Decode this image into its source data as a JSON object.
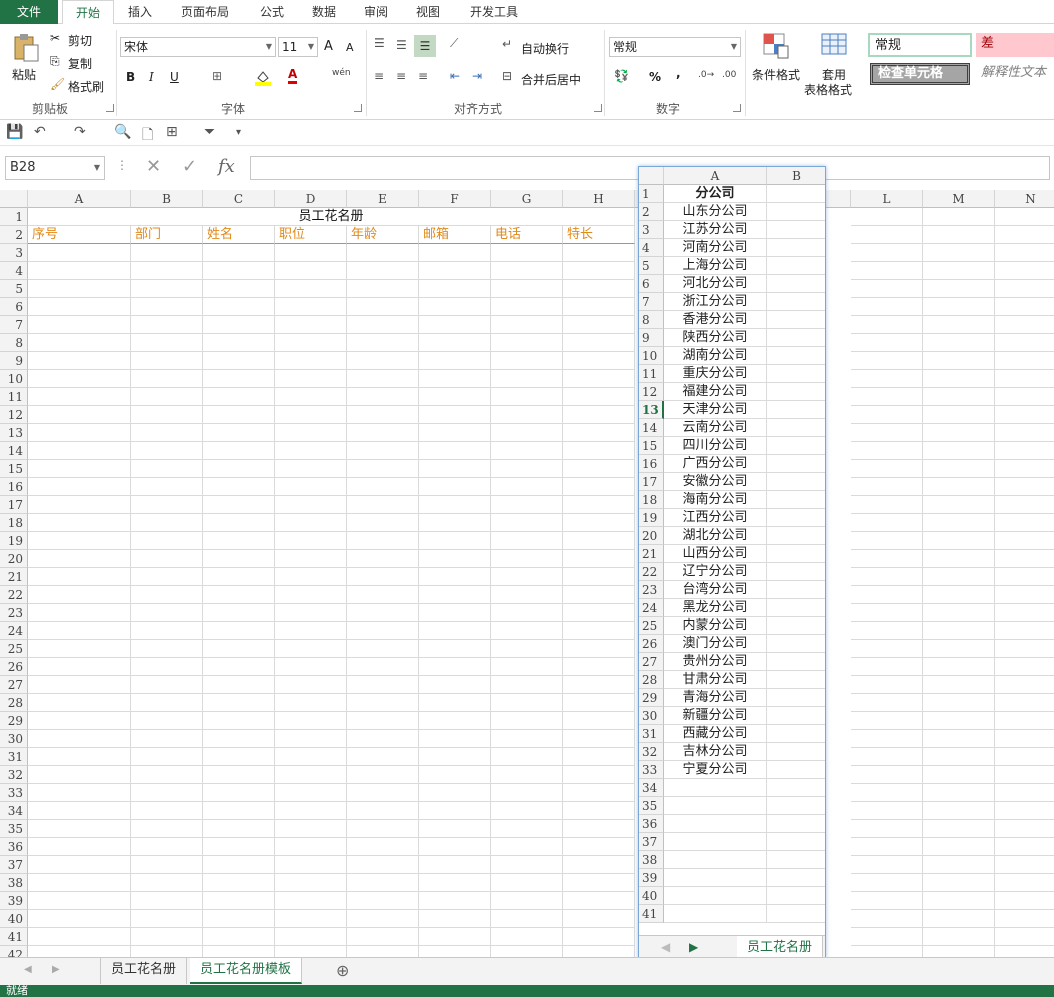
{
  "ribbon": {
    "tabs": [
      "文件",
      "开始",
      "插入",
      "页面布局",
      "公式",
      "数据",
      "审阅",
      "视图",
      "开发工具"
    ],
    "active_tab": "开始",
    "clipboard": {
      "paste": "粘贴",
      "cut": "剪切",
      "copy": "复制",
      "format_painter": "格式刷",
      "label": "剪贴板"
    },
    "font": {
      "name": "宋体",
      "size": "11",
      "bold": "B",
      "italic": "I",
      "underline": "U",
      "label": "字体",
      "grow": "A",
      "shrink": "A",
      "font_color_letter": "A",
      "phonetic": "wén"
    },
    "alignment": {
      "wrap": "自动换行",
      "merge": "合并后居中",
      "label": "对齐方式"
    },
    "number": {
      "format": "常规",
      "percent": "%",
      "comma": ",",
      "label": "数字"
    },
    "styles": {
      "conditional": "条件格式",
      "table_format_line1": "套用",
      "table_format_line2": "表格格式",
      "normal": "常规",
      "bad": "差",
      "check_cell": "检查单元格",
      "explanatory": "解释性文本"
    }
  },
  "formula_bar": {
    "name_box": "B28",
    "fx": "fx",
    "value": ""
  },
  "colors": {
    "accent": "#217346",
    "header_orange": "#e08a1a",
    "bad_bg": "#ffc7ce"
  },
  "main_sheet": {
    "columns": [
      "A",
      "B",
      "C",
      "D",
      "E",
      "F",
      "G",
      "H",
      "L",
      "M",
      "N"
    ],
    "title": "员工花名册",
    "headers": [
      "序号",
      "部门",
      "姓名",
      "职位",
      "年龄",
      "邮箱",
      "电话",
      "特长"
    ],
    "row_numbers": [
      "1",
      "2",
      "3",
      "4",
      "5",
      "6",
      "7",
      "8",
      "9",
      "10",
      "11",
      "12",
      "13",
      "14",
      "15",
      "16",
      "17",
      "18",
      "19",
      "20",
      "21",
      "22",
      "23",
      "24",
      "25",
      "26",
      "27",
      "28",
      "29",
      "30",
      "31",
      "32",
      "33",
      "34",
      "35",
      "36",
      "37",
      "38",
      "39",
      "40",
      "41",
      "42"
    ]
  },
  "floating_window": {
    "columns": [
      "A",
      "B"
    ],
    "header": "分公司",
    "companies": [
      "山东分公司",
      "江苏分公司",
      "河南分公司",
      "上海分公司",
      "河北分公司",
      "浙江分公司",
      "香港分公司",
      "陕西分公司",
      "湖南分公司",
      "重庆分公司",
      "福建分公司",
      "天津分公司",
      "云南分公司",
      "四川分公司",
      "广西分公司",
      "安徽分公司",
      "海南分公司",
      "江西分公司",
      "湖北分公司",
      "山西分公司",
      "辽宁分公司",
      "台湾分公司",
      "黑龙分公司",
      "内蒙分公司",
      "澳门分公司",
      "贵州分公司",
      "甘肃分公司",
      "青海分公司",
      "新疆分公司",
      "西藏分公司",
      "吉林分公司",
      "宁夏分公司"
    ],
    "row_numbers": [
      "1",
      "2",
      "3",
      "4",
      "5",
      "6",
      "7",
      "8",
      "9",
      "10",
      "11",
      "12",
      "13",
      "14",
      "15",
      "16",
      "17",
      "18",
      "19",
      "20",
      "21",
      "22",
      "23",
      "24",
      "25",
      "26",
      "27",
      "28",
      "29",
      "30",
      "31",
      "32",
      "33",
      "34",
      "35",
      "36",
      "37",
      "38",
      "39",
      "40",
      "41"
    ],
    "selected_row": "13",
    "sheet_tab": "员工花名册"
  },
  "sheet_tabs": [
    "员工花名册",
    "员工花名册模板"
  ],
  "active_sheet": "员工花名册模板",
  "status": "就绪"
}
